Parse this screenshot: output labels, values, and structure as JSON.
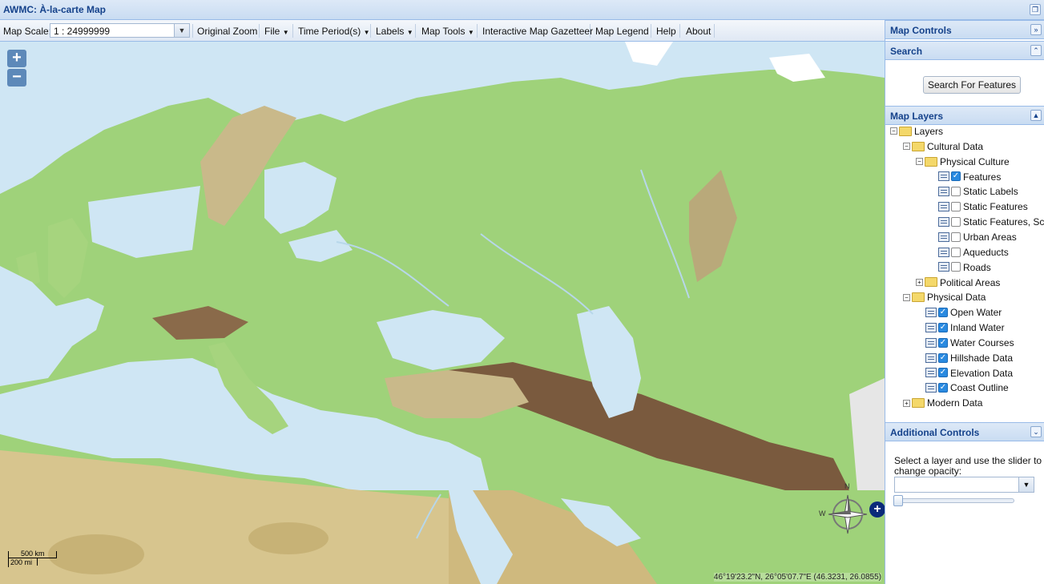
{
  "window": {
    "title": "AWMC: À-la-carte Map"
  },
  "toolbar": {
    "scale_label": "Map Scale:",
    "scale_value": "1 : 24999999",
    "items": [
      "Original Zoom",
      "File",
      "Time Period(s)",
      "Labels",
      "Map Tools",
      "Interactive Map Gazetteer",
      "Map Legend",
      "Help",
      "About"
    ]
  },
  "map": {
    "zoom_in": "+",
    "zoom_out": "−",
    "scale_km": "500 km",
    "scale_mi": "200 mi",
    "coords": "46°19'23.2\"N, 26°05'07.7\"E (46.3231, 26.0855)",
    "compass_n": "N",
    "compass_w": "W"
  },
  "panel": {
    "controls_title": "Map Controls",
    "search_title": "Search",
    "search_button": "Search For Features",
    "layers_title": "Map Layers",
    "additional_title": "Additional Controls",
    "additional_text": "Select a layer and use the slider to change opacity:",
    "opacity_value": 0
  },
  "tree": [
    {
      "label": "Layers",
      "kind": "folder",
      "level": 0,
      "expanded": true
    },
    {
      "label": "Cultural Data",
      "kind": "folder",
      "level": 1,
      "expanded": true
    },
    {
      "label": "Physical Culture",
      "kind": "folder",
      "level": 2,
      "expanded": true
    },
    {
      "label": "Features",
      "kind": "layer",
      "level": 3,
      "checked": true
    },
    {
      "label": "Static Labels",
      "kind": "layer",
      "level": 3,
      "checked": false
    },
    {
      "label": "Static Features",
      "kind": "layer",
      "level": 3,
      "checked": false
    },
    {
      "label": "Static Features, Scaled",
      "kind": "layer",
      "level": 3,
      "checked": false
    },
    {
      "label": "Urban Areas",
      "kind": "layer",
      "level": 3,
      "checked": false
    },
    {
      "label": "Aqueducts",
      "kind": "layer",
      "level": 3,
      "checked": false
    },
    {
      "label": "Roads",
      "kind": "layer",
      "level": 3,
      "checked": false
    },
    {
      "label": "Political Areas",
      "kind": "folder",
      "level": 2,
      "expanded": false
    },
    {
      "label": "Physical Data",
      "kind": "folder",
      "level": 1,
      "expanded": true
    },
    {
      "label": "Open Water",
      "kind": "layer",
      "level": 2,
      "checked": true
    },
    {
      "label": "Inland Water",
      "kind": "layer",
      "level": 2,
      "checked": true
    },
    {
      "label": "Water Courses",
      "kind": "layer",
      "level": 2,
      "checked": true
    },
    {
      "label": "Hillshade Data",
      "kind": "layer",
      "level": 2,
      "checked": true
    },
    {
      "label": "Elevation Data",
      "kind": "layer",
      "level": 2,
      "checked": true
    },
    {
      "label": "Coast Outline",
      "kind": "layer",
      "level": 2,
      "checked": true
    },
    {
      "label": "Modern Data",
      "kind": "folder",
      "level": 1,
      "expanded": false
    }
  ]
}
